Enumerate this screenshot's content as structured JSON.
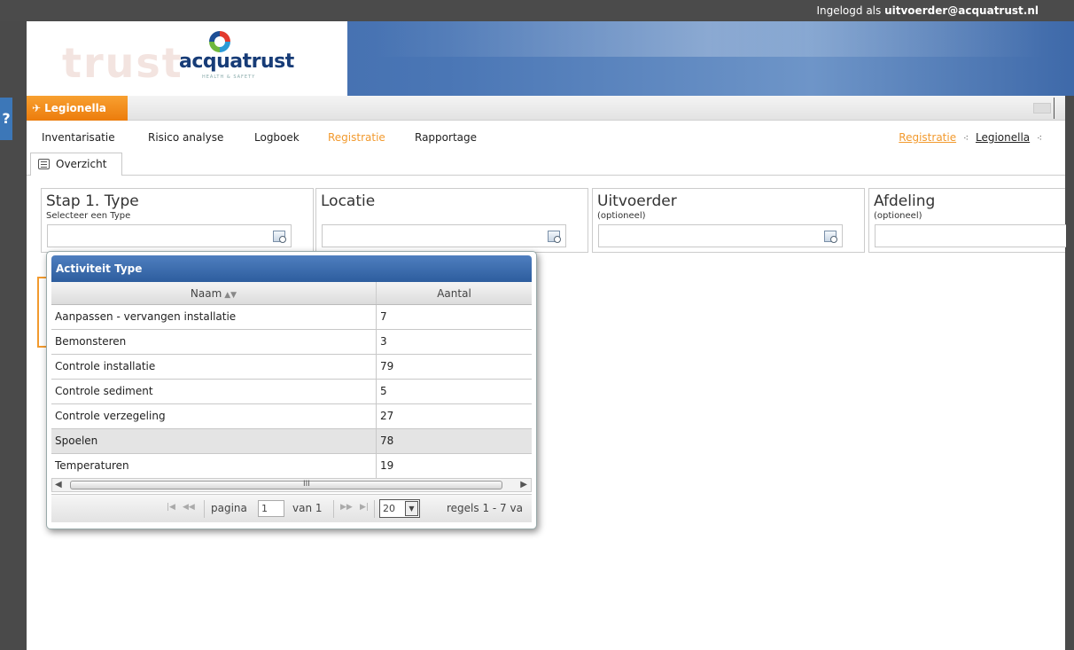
{
  "topbar": {
    "login_prefix": "Ingelogd als",
    "login_user": "uitvoerder@acquatrust.nl"
  },
  "logo": {
    "name": "acquatrust",
    "tagline": "HEALTH & SAFETY",
    "ghost": "trust"
  },
  "help": {
    "label": "?"
  },
  "module": {
    "label": "Legionella"
  },
  "menu": {
    "items": [
      {
        "label": "Inventarisatie"
      },
      {
        "label": "Risico analyse"
      },
      {
        "label": "Logboek"
      },
      {
        "label": "Registratie"
      },
      {
        "label": "Rapportage"
      }
    ]
  },
  "breadcrumb": {
    "first": "Registratie",
    "second": "Legionella",
    "sep": "⁖"
  },
  "subtab": {
    "label": "Overzicht"
  },
  "filters": [
    {
      "title": "Stap 1. Type",
      "sub": "Selecteer een Type"
    },
    {
      "title": "Locatie",
      "sub": ""
    },
    {
      "title": "Uitvoerder",
      "sub": "(optioneel)"
    },
    {
      "title": "Afdeling",
      "sub": "(optioneel)"
    }
  ],
  "popup": {
    "title": "Activiteit Type",
    "col_name": "Naam",
    "col_count": "Aantal",
    "rows": [
      {
        "name": "Aanpassen - vervangen installatie",
        "count": "7"
      },
      {
        "name": "Bemonsteren",
        "count": "3"
      },
      {
        "name": "Controle installatie",
        "count": "79"
      },
      {
        "name": "Controle sediment",
        "count": "5"
      },
      {
        "name": "Controle verzegeling",
        "count": "27"
      },
      {
        "name": "Spoelen",
        "count": "78"
      },
      {
        "name": "Temperaturen",
        "count": "19"
      }
    ],
    "scroll_grip": "III",
    "pager": {
      "page_label": "pagina",
      "page_value": "1",
      "of_label": "van 1",
      "rows_per_page": "20",
      "rows_info": "regels 1 - 7 va"
    }
  },
  "colors": {
    "accent": "#f29a2e",
    "header_blue": "#3c66a8",
    "popup_header": "#2d5d9e"
  }
}
